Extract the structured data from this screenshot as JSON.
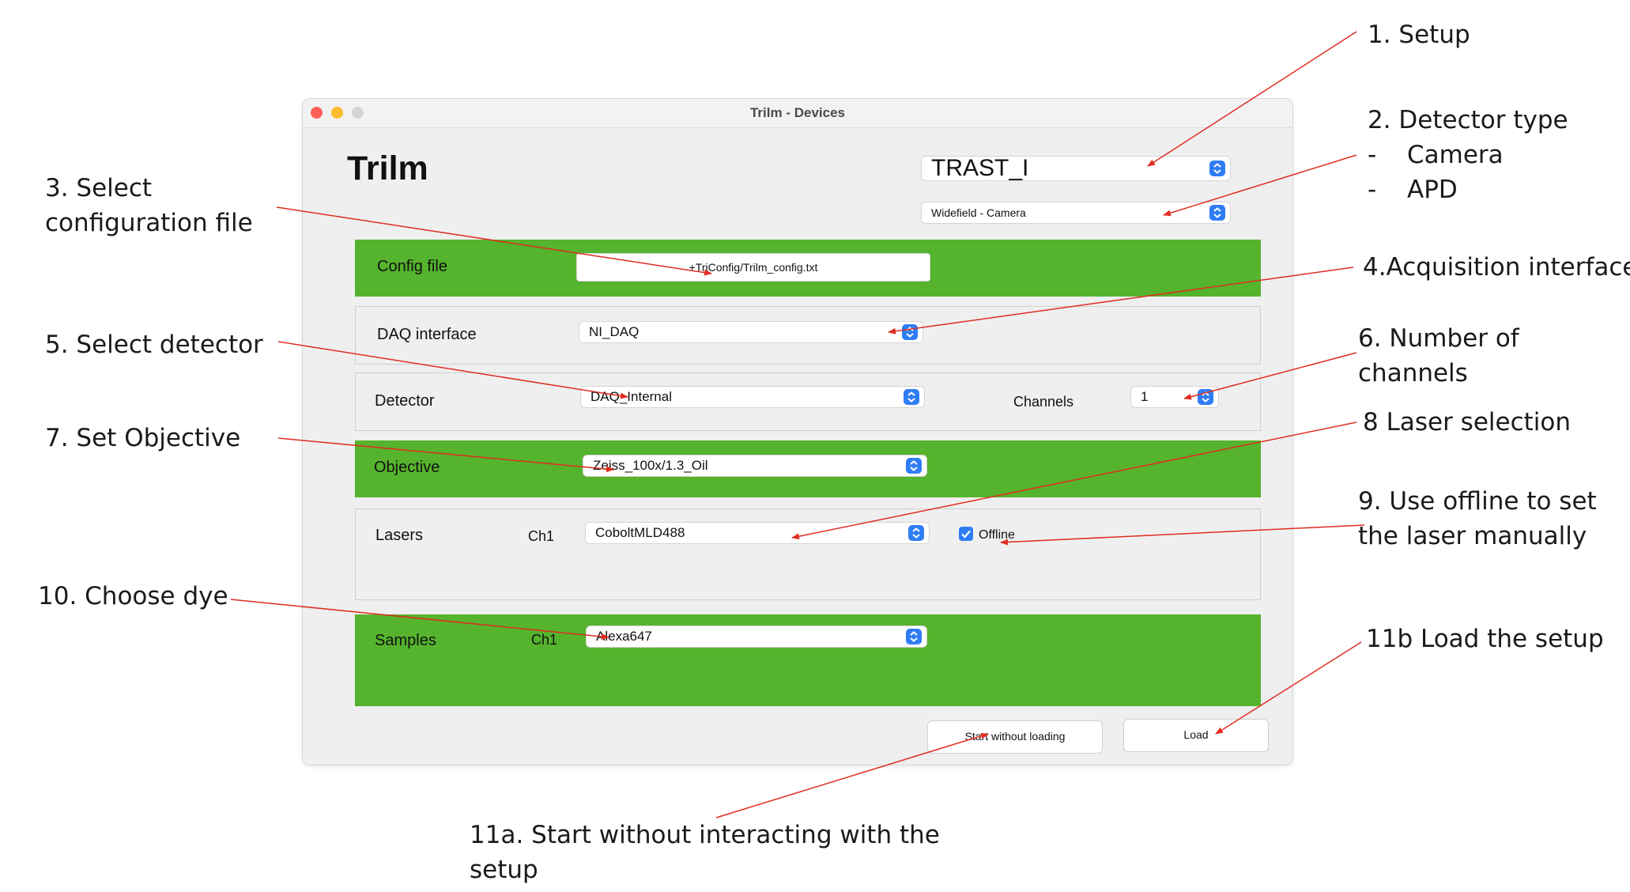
{
  "window": {
    "title": "Trilm - Devices",
    "app_title": "Trilm",
    "setup_select": "TRAST_I",
    "detector_type_select": "Widefield - Camera"
  },
  "config": {
    "label": "Config file",
    "path": "+TriConfig/Trilm_config.txt"
  },
  "daq": {
    "label": "DAQ interface",
    "value": "NI_DAQ"
  },
  "detector": {
    "label": "Detector",
    "value": "DAQ_Internal",
    "channels_label": "Channels",
    "channels_value": "1"
  },
  "objective": {
    "label": "Objective",
    "value": "Zeiss_100x/1.3_Oil"
  },
  "lasers": {
    "label": "Lasers",
    "channel": "Ch1",
    "value": "CoboltMLD488",
    "offline_label": "Offline",
    "offline_checked": true
  },
  "samples": {
    "label": "Samples",
    "channel": "Ch1",
    "value": "Alexa647"
  },
  "buttons": {
    "start": "Start without loading",
    "load": "Load"
  },
  "annotations": {
    "a1": "1. Setup",
    "a2_title": "2. Detector type",
    "a2_dash1": "-",
    "a2_item1": "Camera",
    "a2_dash2": "-",
    "a2_item2": "APD",
    "a3_line1": "3. Select",
    "a3_line2": "configuration file",
    "a4": "4.Acquisition interface",
    "a5": "5. Select detector",
    "a6_line1": "6. Number of",
    "a6_line2": "channels",
    "a7": "7. Set Objective",
    "a8": "8 Laser selection",
    "a9_line1": "9. Use offline to set",
    "a9_line2": "the laser manually",
    "a10": "10. Choose dye",
    "a11b": "11b Load the setup",
    "a11a_line1": "11a. Start without interacting with the",
    "a11a_line2": "setup"
  },
  "colors": {
    "panel_green": "#55b32d",
    "arrow_red": "#e02d20",
    "chevron_blue": "#2f7df6"
  }
}
